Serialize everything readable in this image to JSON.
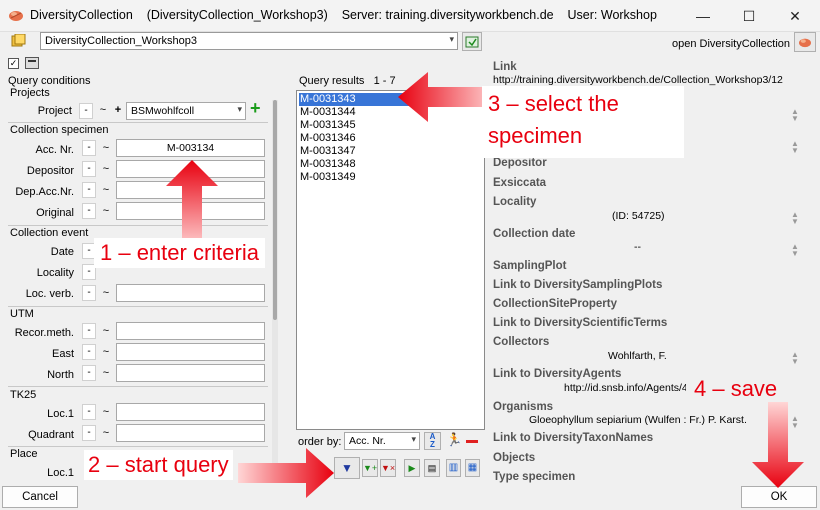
{
  "window": {
    "title": "DiversityCollection",
    "subtitle": "(DiversityCollection_Workshop3)",
    "server": "Server: training.diversityworkbench.de",
    "user": "User: Workshop",
    "minimize": "—",
    "maximize": "☐",
    "close": "✕"
  },
  "toolbar": {
    "database": "DiversityCollection_Workshop3",
    "open_label": "open DiversityCollection"
  },
  "query": {
    "title": "Query conditions",
    "projects_group": "Projects",
    "project_label": "Project",
    "project_value": "BSMwohlfcoll",
    "specimen_group": "Collection specimen",
    "acc_label": "Acc. Nr.",
    "acc_value": "M-003134",
    "depositor_label": "Depositor",
    "depaccnr_label": "Dep.Acc.Nr.",
    "original_label": "Original",
    "event_group": "Collection event",
    "date_label": "Date",
    "locality_label": "Locality",
    "locverb_label": "Loc. verb.",
    "utm_group": "UTM",
    "recor_label": "Recor.meth.",
    "east_label": "East",
    "north_label": "North",
    "tk25_group": "TK25",
    "loc1_label": "Loc.1",
    "quadrant_label": "Quadrant",
    "place_group": "Place",
    "place_loc1_label": "Loc.1",
    "dash": "-",
    "tilde": "~",
    "plus": "+"
  },
  "results": {
    "header": "Query results",
    "count": "1 - 7",
    "items": [
      "M-0031343",
      "M-0031344",
      "M-0031345",
      "M-0031346",
      "M-0031347",
      "M-0031348",
      "M-0031349"
    ],
    "order_by_label": "order by:",
    "order_by_value": "Acc. Nr."
  },
  "details": {
    "link_label": "Link",
    "link_value": "http://training.diversityworkbench.de/Collection_Workshop3/12",
    "depositor": "Depositor",
    "exsiccata": "Exsiccata",
    "locality": "Locality",
    "locality_value": "(ID: 54725)",
    "collection_date": "Collection date",
    "collection_date_value": "--",
    "sampling_plot": "SamplingPlot",
    "link_sampling": "Link to DiversitySamplingPlots",
    "site_property": "CollectionSiteProperty",
    "link_terms": "Link to DiversityScientificTerms",
    "collectors": "Collectors",
    "collectors_value": "Wohlfarth, F.",
    "link_agents": "Link to DiversityAgents",
    "link_agents_value": "http://id.snsb.info/Agents/4",
    "organisms": "Organisms",
    "organisms_value": "Gloeophyllum sepiarium (Wulfen : Fr.) P. Karst.",
    "link_taxon": "Link to DiversityTaxonNames",
    "objects": "Objects",
    "type_specimen": "Type specimen"
  },
  "buttons": {
    "cancel": "Cancel",
    "ok": "OK"
  },
  "annotations": {
    "step1": "1 – enter criteria",
    "step2": "2 – start query",
    "step3_line1": "3 – select the",
    "step3_line2": "specimen",
    "step4": "4 – save"
  },
  "colors": {
    "annotation_red": "#e8000f",
    "selection_blue": "#3875d7",
    "add_green": "#1a9c1a"
  }
}
